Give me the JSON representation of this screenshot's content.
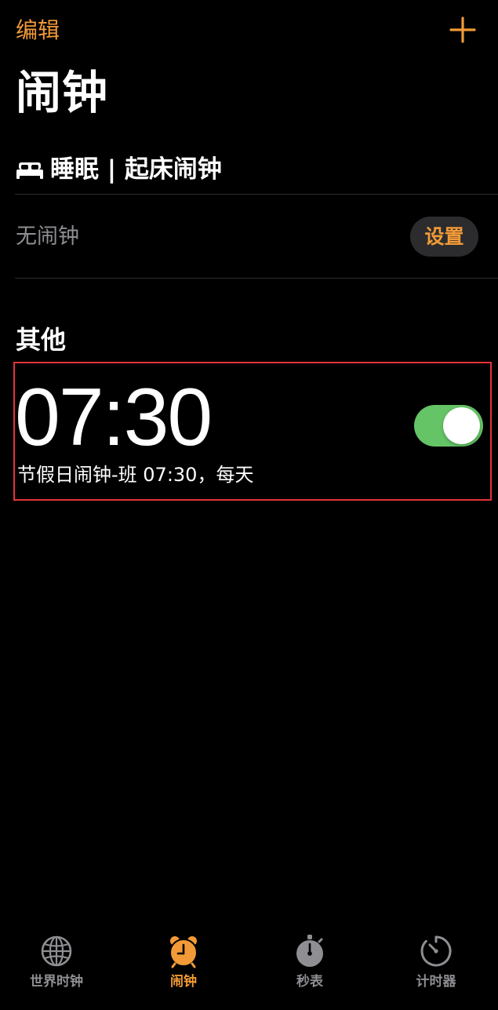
{
  "colors": {
    "accent": "#f19a37",
    "background": "#000000",
    "toggle_on": "#65c466",
    "inactive_tab": "#8e8e93",
    "highlight_border": "#e5333a"
  },
  "header": {
    "edit_label": "编辑",
    "add_icon": "plus-icon",
    "title": "闹钟"
  },
  "sleep": {
    "icon": "bed-icon",
    "title": "睡眠 | 起床闹钟",
    "no_alarm_text": "无闹钟",
    "setup_label": "设置"
  },
  "other": {
    "section_title": "其他",
    "alarms": [
      {
        "time": "07:30",
        "subtitle": "节假日闹钟-班 07:30，每天",
        "enabled": true
      }
    ]
  },
  "tabs": [
    {
      "label": "世界时钟",
      "icon": "globe-icon",
      "active": false
    },
    {
      "label": "闹钟",
      "icon": "alarm-clock-icon",
      "active": true
    },
    {
      "label": "秒表",
      "icon": "stopwatch-icon",
      "active": false
    },
    {
      "label": "计时器",
      "icon": "timer-icon",
      "active": false
    }
  ]
}
